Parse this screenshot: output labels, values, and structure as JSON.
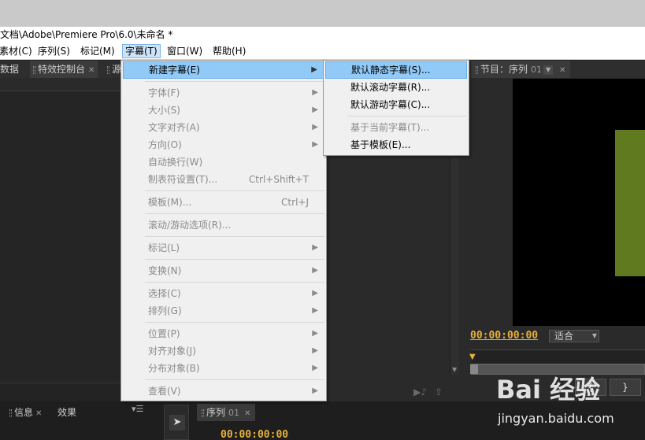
{
  "window": {
    "title": "文档\\Adobe\\Premiere Pro\\6.0\\未命名 *"
  },
  "menubar": {
    "items": [
      {
        "label": "素材(C)"
      },
      {
        "label": "序列(S)"
      },
      {
        "label": "标记(M)"
      },
      {
        "label": "字幕(T)"
      },
      {
        "label": "窗口(W)"
      },
      {
        "label": "帮助(H)"
      }
    ],
    "active": "字幕(T)"
  },
  "panels": {
    "left_tabs": [
      {
        "label": "数据"
      },
      {
        "label": "特效控制台"
      },
      {
        "label": "源"
      }
    ],
    "program": {
      "tab_label": "节目：序列",
      "tab_number": "01",
      "timecode": "00:00:00:00",
      "fit_label": "适合",
      "clip_color": "#5f7a1f"
    },
    "bottom_tabs": [
      {
        "label": "信息"
      },
      {
        "label": "效果"
      }
    ],
    "sequence": {
      "tab_label": "序列",
      "tab_number": "01",
      "timecode": "00:00:00:00"
    }
  },
  "title_menu": {
    "items": [
      {
        "label": "新建字幕(E)",
        "state": "highlighted",
        "has_submenu": true
      },
      {
        "label": "字体(F)",
        "state": "disabled",
        "has_submenu": true
      },
      {
        "label": "大小(S)",
        "state": "disabled",
        "has_submenu": true
      },
      {
        "label": "文字对齐(A)",
        "state": "disabled",
        "has_submenu": true
      },
      {
        "label": "方向(O)",
        "state": "disabled",
        "has_submenu": true
      },
      {
        "label": "自动换行(W)",
        "state": "disabled"
      },
      {
        "label": "制表符设置(T)...",
        "state": "disabled",
        "shortcut": "Ctrl+Shift+T"
      },
      {
        "label": "模板(M)...",
        "state": "disabled",
        "shortcut": "Ctrl+J"
      },
      {
        "label": "滚动/游动选项(R)...",
        "state": "disabled"
      },
      {
        "label": "标记(L)",
        "state": "disabled",
        "has_submenu": true
      },
      {
        "label": "变换(N)",
        "state": "disabled",
        "has_submenu": true
      },
      {
        "label": "选择(C)",
        "state": "disabled",
        "has_submenu": true
      },
      {
        "label": "排列(G)",
        "state": "disabled",
        "has_submenu": true
      },
      {
        "label": "位置(P)",
        "state": "disabled",
        "has_submenu": true
      },
      {
        "label": "对齐对象(J)",
        "state": "disabled",
        "has_submenu": true
      },
      {
        "label": "分布对象(B)",
        "state": "disabled",
        "has_submenu": true
      },
      {
        "label": "查看(V)",
        "state": "disabled",
        "has_submenu": true
      }
    ]
  },
  "new_title_submenu": {
    "items": [
      {
        "label": "默认静态字幕(S)...",
        "state": "highlighted"
      },
      {
        "label": "默认滚动字幕(R)...",
        "state": "enabled"
      },
      {
        "label": "默认游动字幕(C)...",
        "state": "enabled"
      },
      {
        "label": "基于当前字幕(T)...",
        "state": "disabled"
      },
      {
        "label": "基于模板(E)...",
        "state": "enabled"
      }
    ]
  },
  "watermark": {
    "brand": "Bai 经验",
    "url": "jingyan.baidu.com"
  },
  "colors": {
    "menu_highlight": "#91c9f7",
    "timecode": "#e6b13a"
  }
}
